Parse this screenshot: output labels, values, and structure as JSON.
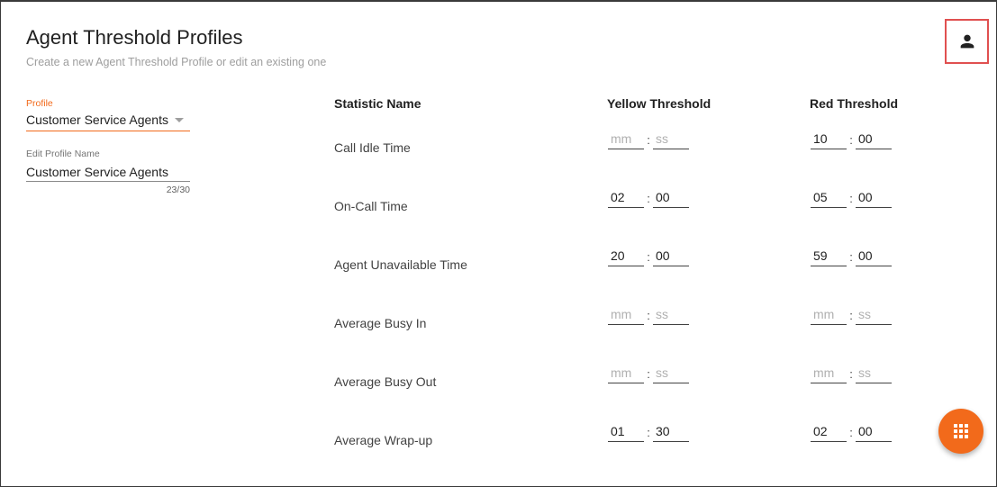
{
  "header": {
    "title": "Agent Threshold Profiles",
    "subtitle": "Create a new Agent Threshold Profile or edit an existing one",
    "user_icon": "person-icon"
  },
  "profile": {
    "label": "Profile",
    "selected": "Customer Service Agents",
    "accent_color": "#f26a1b"
  },
  "edit_profile": {
    "label": "Edit Profile Name",
    "value": "Customer Service Agents",
    "counter": "23/30"
  },
  "table": {
    "headers": {
      "statistic": "Statistic Name",
      "yellow": "Yellow Threshold",
      "red": "Red Threshold"
    },
    "placeholders": {
      "mm": "mm",
      "ss": "ss"
    },
    "separator": ":",
    "rows": [
      {
        "name": "Call Idle Time",
        "yellow": {
          "mm": "",
          "ss": ""
        },
        "red": {
          "mm": "10",
          "ss": "00"
        }
      },
      {
        "name": "On-Call Time",
        "yellow": {
          "mm": "02",
          "ss": "00"
        },
        "red": {
          "mm": "05",
          "ss": "00"
        }
      },
      {
        "name": "Agent Unavailable Time",
        "yellow": {
          "mm": "20",
          "ss": "00"
        },
        "red": {
          "mm": "59",
          "ss": "00"
        }
      },
      {
        "name": "Average Busy In",
        "yellow": {
          "mm": "",
          "ss": ""
        },
        "red": {
          "mm": "",
          "ss": ""
        }
      },
      {
        "name": "Average Busy Out",
        "yellow": {
          "mm": "",
          "ss": ""
        },
        "red": {
          "mm": "",
          "ss": ""
        }
      },
      {
        "name": "Average Wrap-up",
        "yellow": {
          "mm": "01",
          "ss": "30"
        },
        "red": {
          "mm": "02",
          "ss": "00"
        }
      }
    ]
  },
  "fab": {
    "icon": "apps-grid-icon",
    "color": "#f26a1b"
  }
}
